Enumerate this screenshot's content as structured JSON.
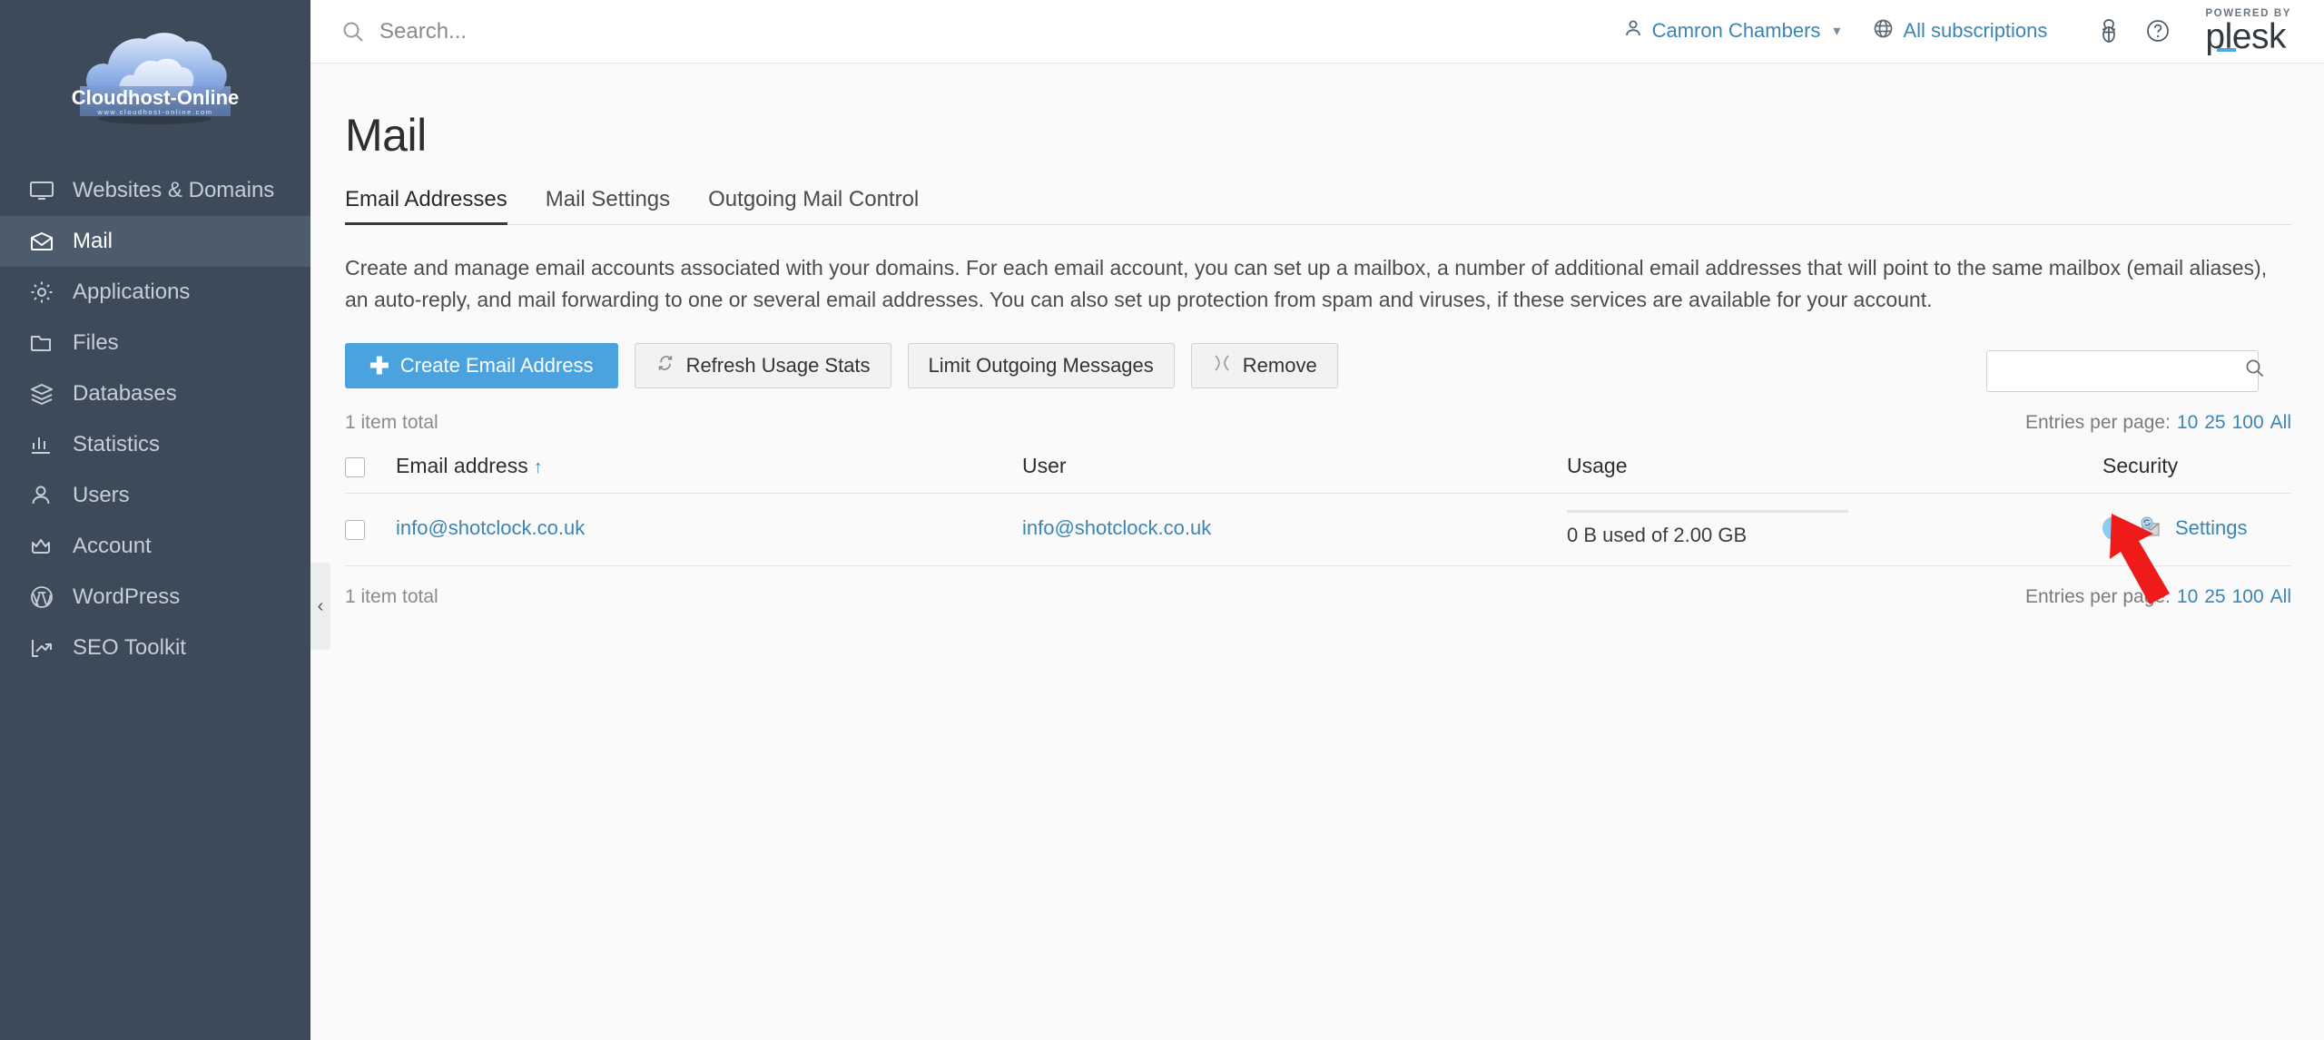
{
  "brand": {
    "logo_title": "Cloudhost-Online",
    "logo_subtitle": "www.cloudhost-online.com",
    "plesk_powered": "POWERED BY",
    "plesk_word": "plesk"
  },
  "topbar": {
    "search_placeholder": "Search...",
    "search_value": "",
    "user_name": "Camron Chambers",
    "subscriptions_label": "All subscriptions",
    "icons": [
      "search-icon",
      "user-icon",
      "globe-icon",
      "caret-down-icon",
      "extensions-icon",
      "help-icon"
    ]
  },
  "sidebar": {
    "items": [
      {
        "label": "Websites & Domains",
        "icon": "monitor-icon",
        "active": false
      },
      {
        "label": "Mail",
        "icon": "envelope-icon",
        "active": true
      },
      {
        "label": "Applications",
        "icon": "gear-icon",
        "active": false
      },
      {
        "label": "Files",
        "icon": "folder-icon",
        "active": false
      },
      {
        "label": "Databases",
        "icon": "database-stack-icon",
        "active": false
      },
      {
        "label": "Statistics",
        "icon": "bar-chart-icon",
        "active": false
      },
      {
        "label": "Users",
        "icon": "person-icon",
        "active": false
      },
      {
        "label": "Account",
        "icon": "crown-icon",
        "active": false
      },
      {
        "label": "WordPress",
        "icon": "wordpress-icon",
        "active": false
      },
      {
        "label": "SEO Toolkit",
        "icon": "trending-up-icon",
        "active": false
      }
    ],
    "collapse_glyph": "‹"
  },
  "page": {
    "title": "Mail",
    "tabs": [
      {
        "label": "Email Addresses",
        "active": true
      },
      {
        "label": "Mail Settings",
        "active": false
      },
      {
        "label": "Outgoing Mail Control",
        "active": false
      }
    ],
    "description": "Create and manage email accounts associated with your domains. For each email account, you can set up a mailbox, a number of additional email addresses that will point to the same mailbox (email aliases), an auto-reply, and mail forwarding to one or several email addresses. You can also set up protection from spam and viruses, if these services are available for your account."
  },
  "toolbar": {
    "create_label": "Create Email Address",
    "refresh_label": "Refresh Usage Stats",
    "limit_label": "Limit Outgoing Messages",
    "remove_label": "Remove",
    "search_value": "",
    "search_placeholder": ""
  },
  "list": {
    "item_total_top": "1 item total",
    "item_total_bottom": "1 item total",
    "entries_label": "Entries per page:",
    "entries_options": [
      "10",
      "25",
      "100",
      "All"
    ],
    "entries_selected": "10",
    "columns": [
      "Email address",
      "User",
      "Usage",
      "Security"
    ],
    "sort_column": "Email address",
    "sort_arrow": "↑",
    "rows": [
      {
        "checked": false,
        "email": "info@shotclock.co.uk",
        "user": "info@shotclock.co.uk",
        "usage": "0 B used of 2.00 GB",
        "usage_percent": 0,
        "security_settings_label": "Settings",
        "security_icons": [
          "info-icon",
          "mail-sync-icon"
        ]
      }
    ]
  },
  "annotation": {
    "arrow_color": "#ef1b1b",
    "points_at": "info-icon"
  }
}
